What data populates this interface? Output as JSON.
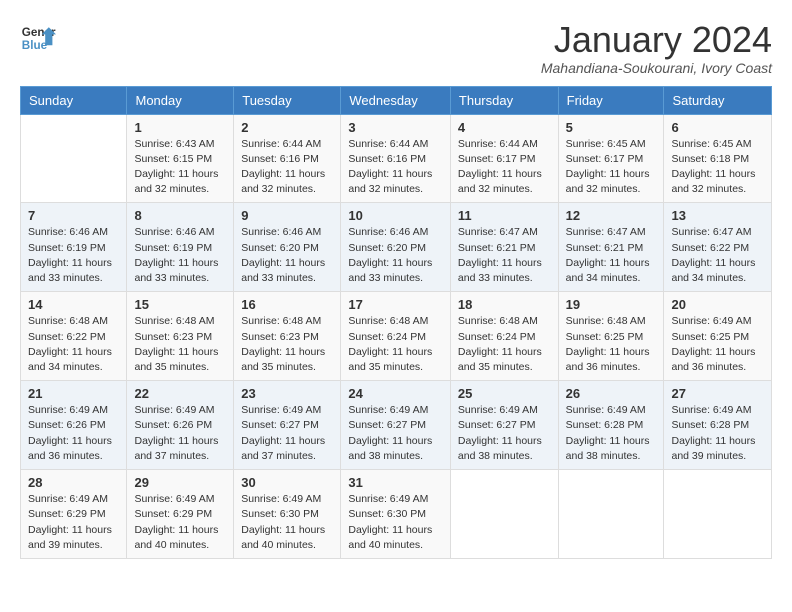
{
  "logo": {
    "text_general": "General",
    "text_blue": "Blue"
  },
  "title": "January 2024",
  "location": "Mahandiana-Soukourani, Ivory Coast",
  "days_of_week": [
    "Sunday",
    "Monday",
    "Tuesday",
    "Wednesday",
    "Thursday",
    "Friday",
    "Saturday"
  ],
  "weeks": [
    [
      {
        "day": "",
        "sunrise": "",
        "sunset": "",
        "daylight": ""
      },
      {
        "day": "1",
        "sunrise": "Sunrise: 6:43 AM",
        "sunset": "Sunset: 6:15 PM",
        "daylight": "Daylight: 11 hours and 32 minutes."
      },
      {
        "day": "2",
        "sunrise": "Sunrise: 6:44 AM",
        "sunset": "Sunset: 6:16 PM",
        "daylight": "Daylight: 11 hours and 32 minutes."
      },
      {
        "day": "3",
        "sunrise": "Sunrise: 6:44 AM",
        "sunset": "Sunset: 6:16 PM",
        "daylight": "Daylight: 11 hours and 32 minutes."
      },
      {
        "day": "4",
        "sunrise": "Sunrise: 6:44 AM",
        "sunset": "Sunset: 6:17 PM",
        "daylight": "Daylight: 11 hours and 32 minutes."
      },
      {
        "day": "5",
        "sunrise": "Sunrise: 6:45 AM",
        "sunset": "Sunset: 6:17 PM",
        "daylight": "Daylight: 11 hours and 32 minutes."
      },
      {
        "day": "6",
        "sunrise": "Sunrise: 6:45 AM",
        "sunset": "Sunset: 6:18 PM",
        "daylight": "Daylight: 11 hours and 32 minutes."
      }
    ],
    [
      {
        "day": "7",
        "sunrise": "Sunrise: 6:46 AM",
        "sunset": "Sunset: 6:19 PM",
        "daylight": "Daylight: 11 hours and 33 minutes."
      },
      {
        "day": "8",
        "sunrise": "Sunrise: 6:46 AM",
        "sunset": "Sunset: 6:19 PM",
        "daylight": "Daylight: 11 hours and 33 minutes."
      },
      {
        "day": "9",
        "sunrise": "Sunrise: 6:46 AM",
        "sunset": "Sunset: 6:20 PM",
        "daylight": "Daylight: 11 hours and 33 minutes."
      },
      {
        "day": "10",
        "sunrise": "Sunrise: 6:46 AM",
        "sunset": "Sunset: 6:20 PM",
        "daylight": "Daylight: 11 hours and 33 minutes."
      },
      {
        "day": "11",
        "sunrise": "Sunrise: 6:47 AM",
        "sunset": "Sunset: 6:21 PM",
        "daylight": "Daylight: 11 hours and 33 minutes."
      },
      {
        "day": "12",
        "sunrise": "Sunrise: 6:47 AM",
        "sunset": "Sunset: 6:21 PM",
        "daylight": "Daylight: 11 hours and 34 minutes."
      },
      {
        "day": "13",
        "sunrise": "Sunrise: 6:47 AM",
        "sunset": "Sunset: 6:22 PM",
        "daylight": "Daylight: 11 hours and 34 minutes."
      }
    ],
    [
      {
        "day": "14",
        "sunrise": "Sunrise: 6:48 AM",
        "sunset": "Sunset: 6:22 PM",
        "daylight": "Daylight: 11 hours and 34 minutes."
      },
      {
        "day": "15",
        "sunrise": "Sunrise: 6:48 AM",
        "sunset": "Sunset: 6:23 PM",
        "daylight": "Daylight: 11 hours and 35 minutes."
      },
      {
        "day": "16",
        "sunrise": "Sunrise: 6:48 AM",
        "sunset": "Sunset: 6:23 PM",
        "daylight": "Daylight: 11 hours and 35 minutes."
      },
      {
        "day": "17",
        "sunrise": "Sunrise: 6:48 AM",
        "sunset": "Sunset: 6:24 PM",
        "daylight": "Daylight: 11 hours and 35 minutes."
      },
      {
        "day": "18",
        "sunrise": "Sunrise: 6:48 AM",
        "sunset": "Sunset: 6:24 PM",
        "daylight": "Daylight: 11 hours and 35 minutes."
      },
      {
        "day": "19",
        "sunrise": "Sunrise: 6:48 AM",
        "sunset": "Sunset: 6:25 PM",
        "daylight": "Daylight: 11 hours and 36 minutes."
      },
      {
        "day": "20",
        "sunrise": "Sunrise: 6:49 AM",
        "sunset": "Sunset: 6:25 PM",
        "daylight": "Daylight: 11 hours and 36 minutes."
      }
    ],
    [
      {
        "day": "21",
        "sunrise": "Sunrise: 6:49 AM",
        "sunset": "Sunset: 6:26 PM",
        "daylight": "Daylight: 11 hours and 36 minutes."
      },
      {
        "day": "22",
        "sunrise": "Sunrise: 6:49 AM",
        "sunset": "Sunset: 6:26 PM",
        "daylight": "Daylight: 11 hours and 37 minutes."
      },
      {
        "day": "23",
        "sunrise": "Sunrise: 6:49 AM",
        "sunset": "Sunset: 6:27 PM",
        "daylight": "Daylight: 11 hours and 37 minutes."
      },
      {
        "day": "24",
        "sunrise": "Sunrise: 6:49 AM",
        "sunset": "Sunset: 6:27 PM",
        "daylight": "Daylight: 11 hours and 38 minutes."
      },
      {
        "day": "25",
        "sunrise": "Sunrise: 6:49 AM",
        "sunset": "Sunset: 6:27 PM",
        "daylight": "Daylight: 11 hours and 38 minutes."
      },
      {
        "day": "26",
        "sunrise": "Sunrise: 6:49 AM",
        "sunset": "Sunset: 6:28 PM",
        "daylight": "Daylight: 11 hours and 38 minutes."
      },
      {
        "day": "27",
        "sunrise": "Sunrise: 6:49 AM",
        "sunset": "Sunset: 6:28 PM",
        "daylight": "Daylight: 11 hours and 39 minutes."
      }
    ],
    [
      {
        "day": "28",
        "sunrise": "Sunrise: 6:49 AM",
        "sunset": "Sunset: 6:29 PM",
        "daylight": "Daylight: 11 hours and 39 minutes."
      },
      {
        "day": "29",
        "sunrise": "Sunrise: 6:49 AM",
        "sunset": "Sunset: 6:29 PM",
        "daylight": "Daylight: 11 hours and 40 minutes."
      },
      {
        "day": "30",
        "sunrise": "Sunrise: 6:49 AM",
        "sunset": "Sunset: 6:30 PM",
        "daylight": "Daylight: 11 hours and 40 minutes."
      },
      {
        "day": "31",
        "sunrise": "Sunrise: 6:49 AM",
        "sunset": "Sunset: 6:30 PM",
        "daylight": "Daylight: 11 hours and 40 minutes."
      },
      {
        "day": "",
        "sunrise": "",
        "sunset": "",
        "daylight": ""
      },
      {
        "day": "",
        "sunrise": "",
        "sunset": "",
        "daylight": ""
      },
      {
        "day": "",
        "sunrise": "",
        "sunset": "",
        "daylight": ""
      }
    ]
  ]
}
